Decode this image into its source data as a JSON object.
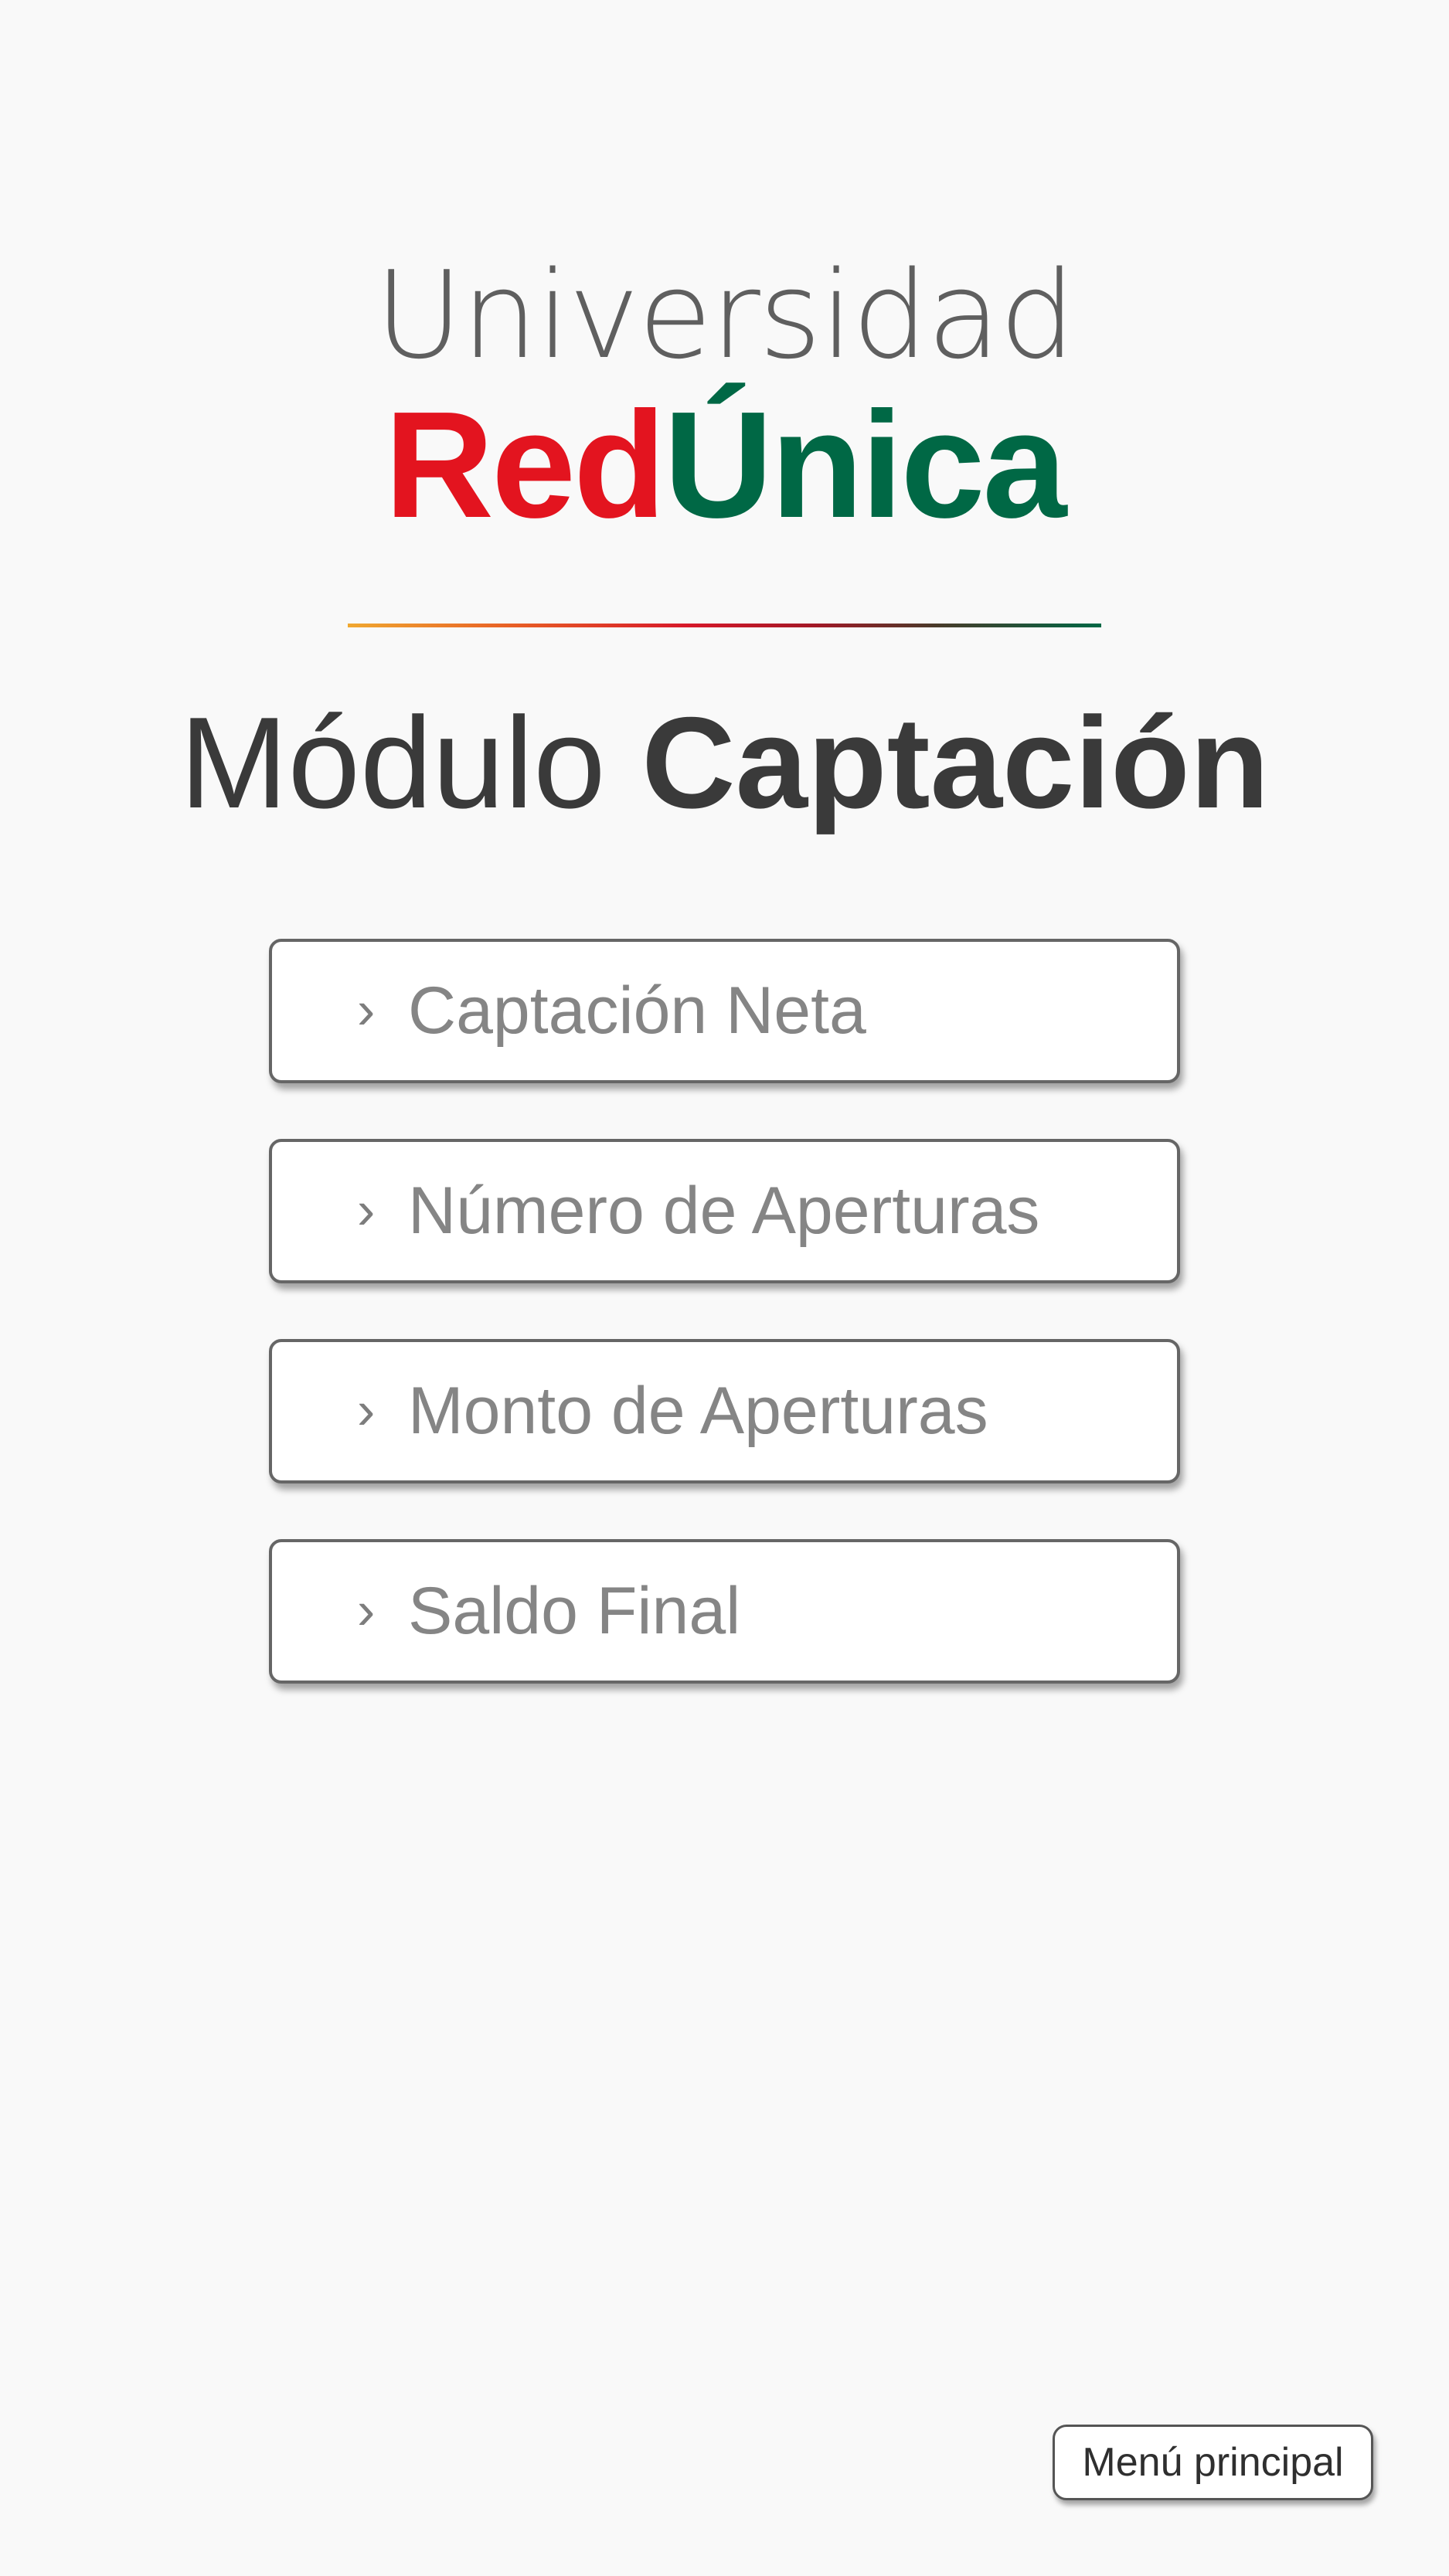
{
  "logo": {
    "line1": "Universidad",
    "line2_red": "Red",
    "line2_green": "Única",
    "colors": {
      "red": "#e3141f",
      "green": "#006845",
      "gray": "#5f5f5f"
    }
  },
  "title": {
    "light": "Módulo ",
    "bold": "Captación"
  },
  "menu": {
    "chevron_icon": "›",
    "items": [
      {
        "label": "Captación Neta"
      },
      {
        "label": "Número de Aperturas"
      },
      {
        "label": "Monto de Aperturas"
      },
      {
        "label": "Saldo Final"
      }
    ]
  },
  "footer": {
    "main_menu_label": "Menú principal"
  }
}
